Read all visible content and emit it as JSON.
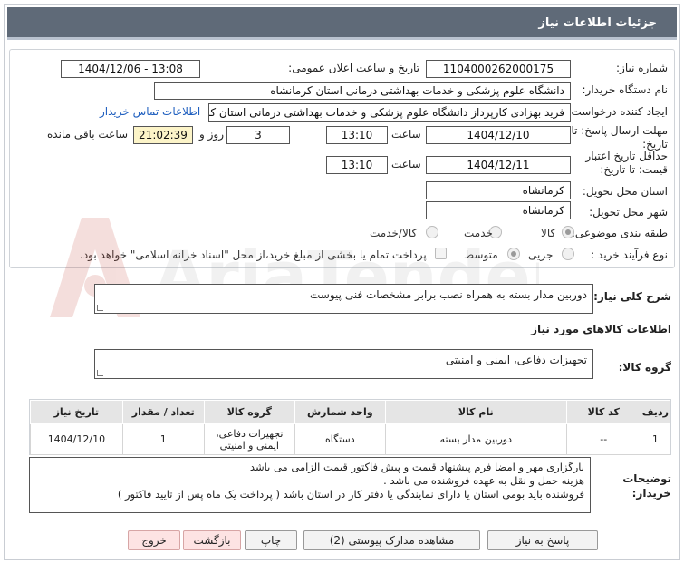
{
  "header": {
    "title": "جزئیات اطلاعات نیاز"
  },
  "form": {
    "need_number_label": "شماره نیاز:",
    "need_number": "1104000262000175",
    "announce_label": "تاریخ و ساعت اعلان عمومی:",
    "announce_value": "1404/12/06 - 13:08",
    "buyer_org_label": "نام دستگاه خریدار:",
    "buyer_org": "دانشگاه علوم پزشکی و خدمات بهداشتی  درمانی استان کرمانشاه",
    "requester_label": "ایجاد کننده درخواست:",
    "requester": "فرید  بهزادی کارپرداز دانشگاه علوم پزشکی و خدمات بهداشتی  درمانی استان کرمانشاه",
    "contact_link": "اطلاعات تماس خریدار",
    "reply_deadline_label": "مهلت ارسال پاسخ: تا تاریخ:",
    "reply_date": "1404/12/10",
    "time_label": "ساعت",
    "reply_time": "13:10",
    "days": "3",
    "days_label": "روز و",
    "remaining": "21:02:39",
    "remaining_label": "ساعت باقی مانده",
    "price_validity_label": "حداقل تاریخ اعتبار قیمت: تا تاریخ:",
    "validity_date": "1404/12/11",
    "validity_time": "13:10",
    "province_label": "استان محل تحویل:",
    "province": "کرمانشاه",
    "city_label": "شهر محل تحویل:",
    "city": "کرمانشاه",
    "category_label": "طبقه بندی موضوعی:",
    "category_options": [
      "کالا",
      "خدمت",
      "کالا/خدمت"
    ],
    "process_label": "نوع فرآیند خرید :",
    "process_options": [
      "جزیی",
      "متوسط"
    ],
    "payment_note": "پرداخت تمام یا بخشی از مبلغ خرید،از محل \"اسناد خزانه اسلامی\" خواهد بود."
  },
  "summary": {
    "label": "شرح کلی نیاز:",
    "text": "دوربین مدار بسته به همراه نصب برابر مشخصات فنی پیوست"
  },
  "goods_section": {
    "title": "اطلاعات کالاهای مورد نیاز",
    "group_label": "گروه کالا:",
    "group_value": "تجهیزات دفاعی، ایمنی و امنیتی"
  },
  "table": {
    "headers": [
      "ردیف",
      "کد کالا",
      "نام کالا",
      "واحد شمارش",
      "گروه کالا",
      "تعداد / مقدار",
      "تاریخ نیاز"
    ],
    "rows": [
      [
        "1",
        "--",
        "دوربین مدار بسته",
        "دستگاه",
        "تجهیزات دفاعی، ایمنی و امنیتی",
        "1",
        "1404/12/10"
      ]
    ]
  },
  "notes": {
    "label": "توضیحات خریدار:",
    "lines": [
      "بارگزاری مهر و امضا فرم پیشنهاد  قیمت و  پیش فاکتور  قیمت الزامی می باشد",
      "هزینه حمل و نقل به عهده فروشنده می باشد .",
      "فروشنده باید بومی استان یا دارای نمایندگی یا دفتر کار در استان باشد ( پرداخت یک ماه پس از تایید فاکتور )"
    ]
  },
  "buttons": {
    "reply": "پاسخ به نیاز",
    "attachments": "مشاهده مدارک پیوستی (2)",
    "print": "چاپ",
    "back": "بازگشت",
    "exit": "خروج"
  },
  "watermark_text": "AriaTender.neT"
}
